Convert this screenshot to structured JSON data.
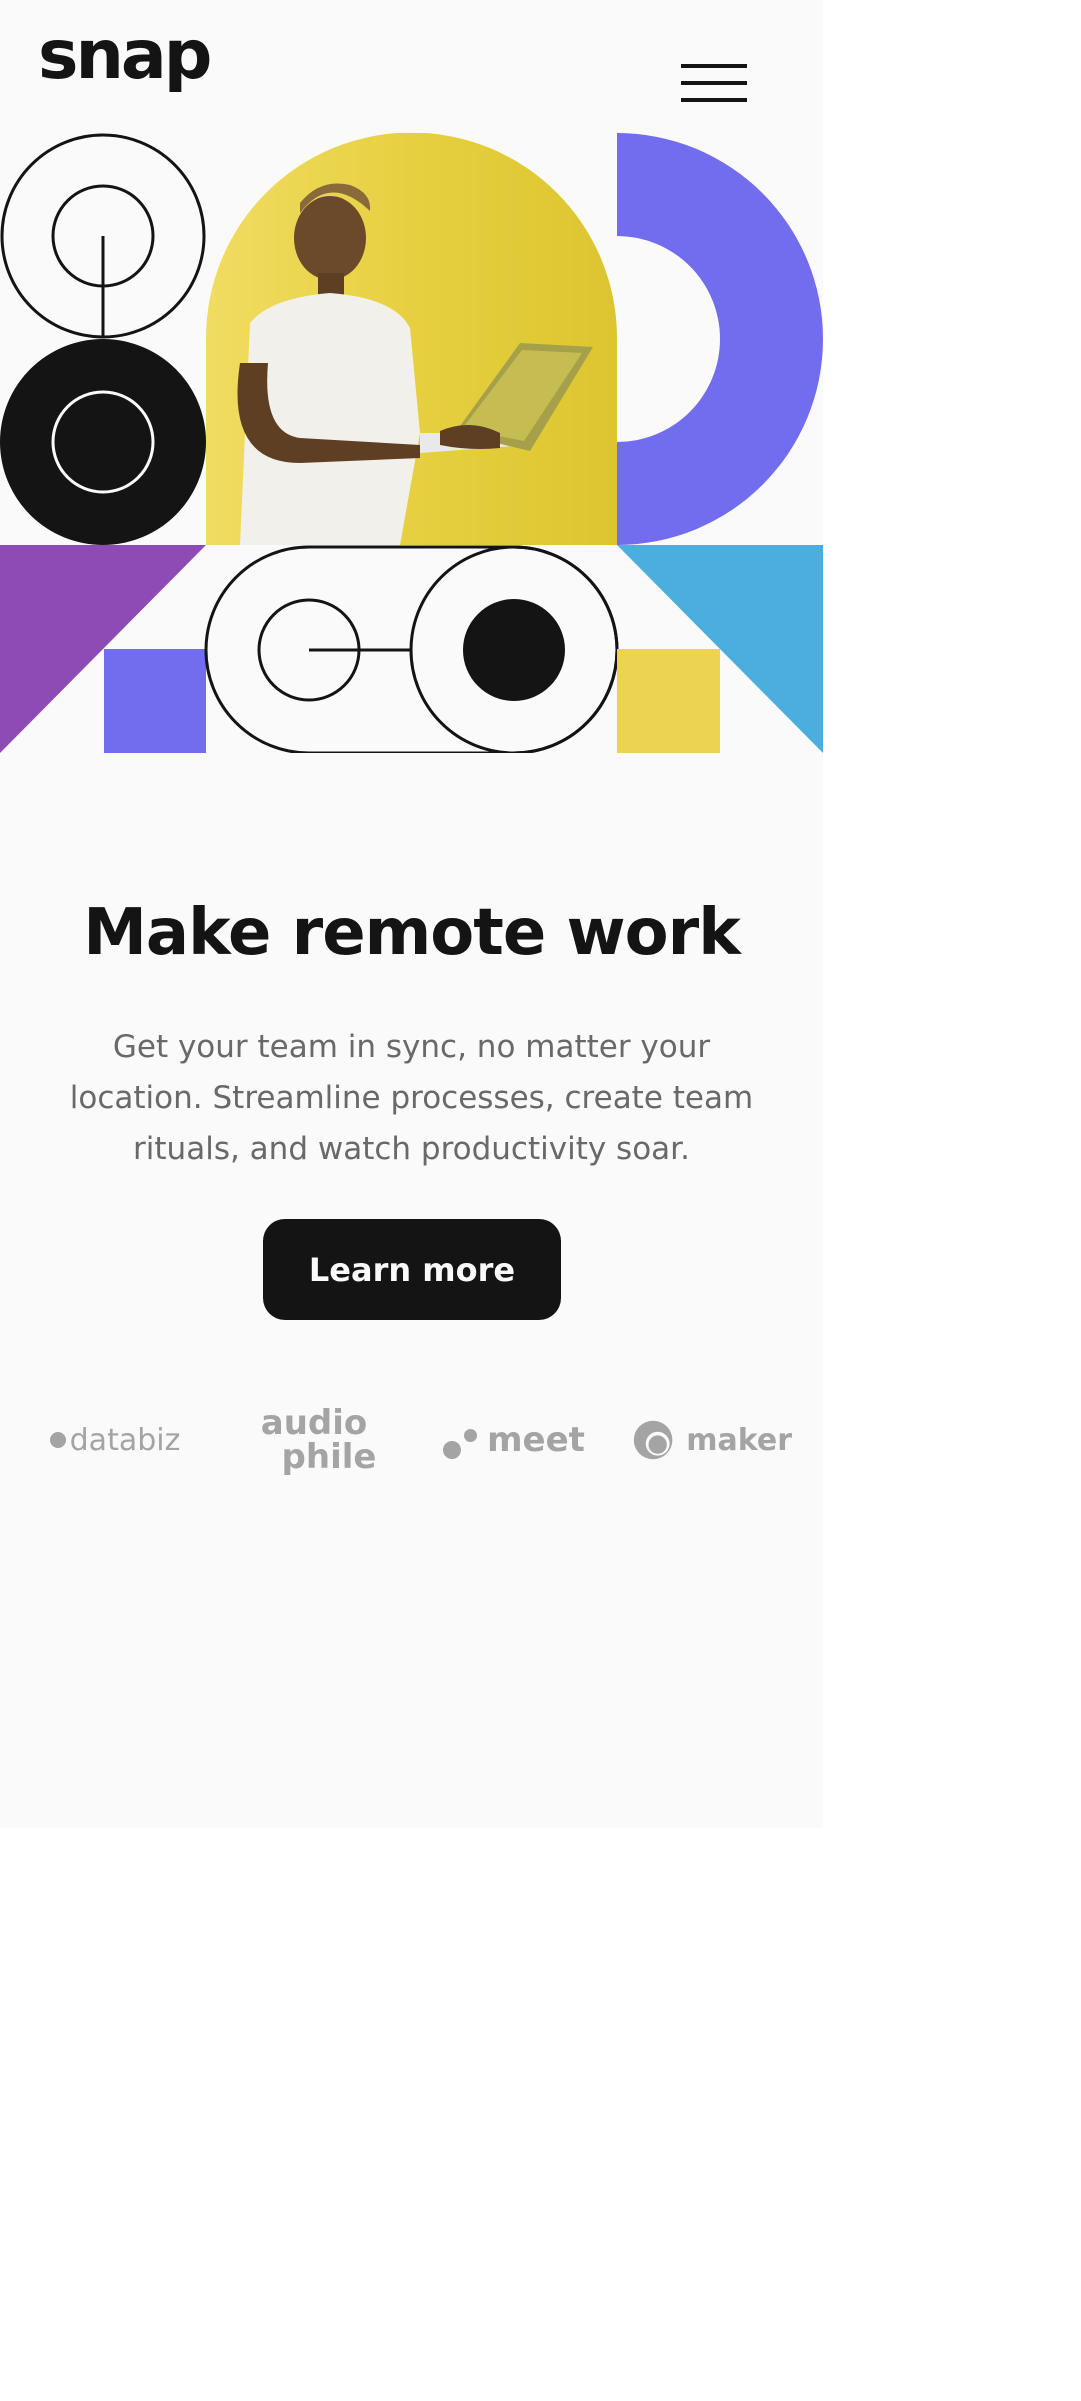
{
  "header": {
    "logo_text": "snap",
    "menu_icon": "hamburger-menu-icon"
  },
  "hero": {
    "image_alt": "Person holding a laptop against a yellow background",
    "colors": {
      "yellow": "#e5cf3d",
      "purple": "#726cee",
      "violet": "#8e4bb5",
      "blue": "#4baedc",
      "black": "#141414"
    }
  },
  "main": {
    "headline": "Make remote work",
    "subtext": "Get your team in sync, no matter your location. Streamline processes, create team rituals, and watch productivity soar.",
    "cta_label": "Learn more"
  },
  "clients": [
    {
      "name": "databiz",
      "icon": "databiz-logo"
    },
    {
      "name": "audiophile",
      "line1": "audio",
      "line2": "phile",
      "icon": "audiophile-logo"
    },
    {
      "name": "meet",
      "icon": "meet-logo"
    },
    {
      "name": "maker",
      "icon": "maker-logo"
    }
  ],
  "colors": {
    "background": "#fafafa",
    "text_dark": "#141414",
    "text_muted": "#696969",
    "logo_gray": "#a4a4a4"
  }
}
